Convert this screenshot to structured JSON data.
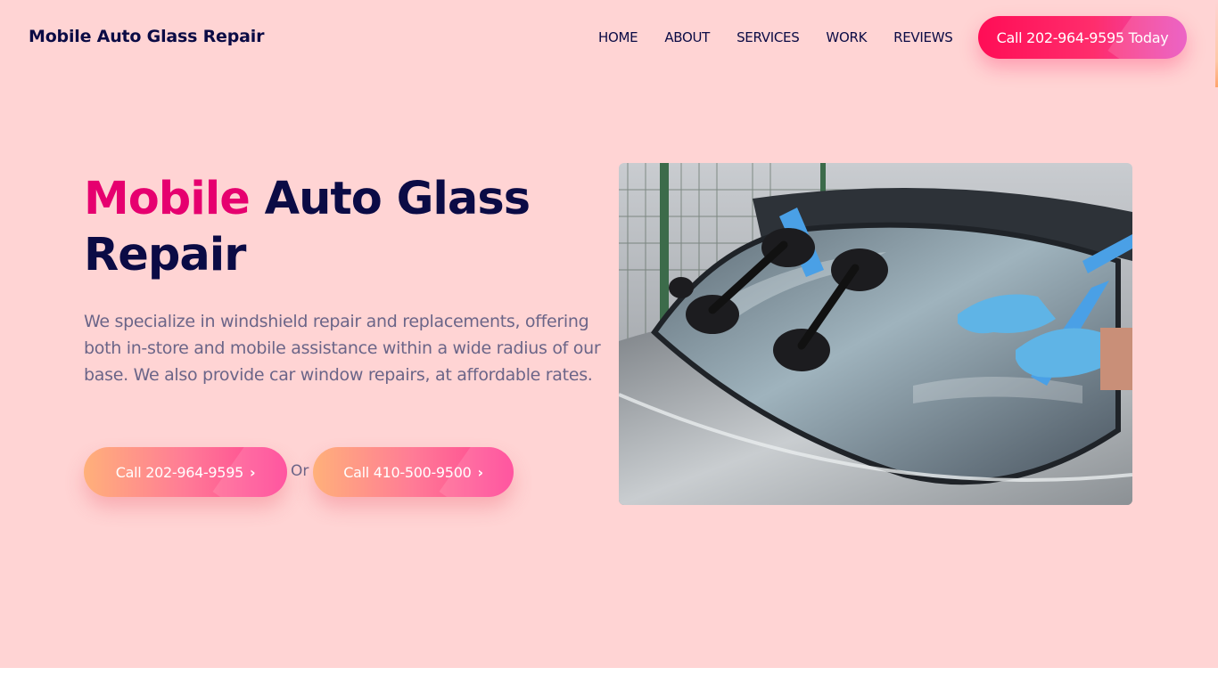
{
  "header": {
    "brand": "Mobile Auto Glass Repair",
    "nav": [
      {
        "label": "HOME"
      },
      {
        "label": "ABOUT"
      },
      {
        "label": "SERVICES"
      },
      {
        "label": "WORK"
      },
      {
        "label": "REVIEWS"
      }
    ],
    "cta_label": "Call 202-964-9595 Today"
  },
  "hero": {
    "title_accent": "Mobile",
    "title_rest": "Auto Glass Repair",
    "description": "We specialize in windshield repair and replacements, offering both in-store and mobile assistance within a wide radius of our base. We also provide car window repairs, at affordable rates.",
    "button_primary": "Call 202-964-9595",
    "separator": "Or",
    "button_secondary": "Call 410-500-9500",
    "chevron_icon": "chevron-right-icon",
    "image_icon": "windshield-repair-photo"
  },
  "colors": {
    "background": "#ffd4d4",
    "brand_dark": "#0b0b45",
    "accent": "#e6006f",
    "body_text": "#6b6588",
    "cta_gradient_start": "#ff0d56",
    "button_gradient_start": "#ffb07a",
    "button_gradient_end": "#ff3e93"
  }
}
